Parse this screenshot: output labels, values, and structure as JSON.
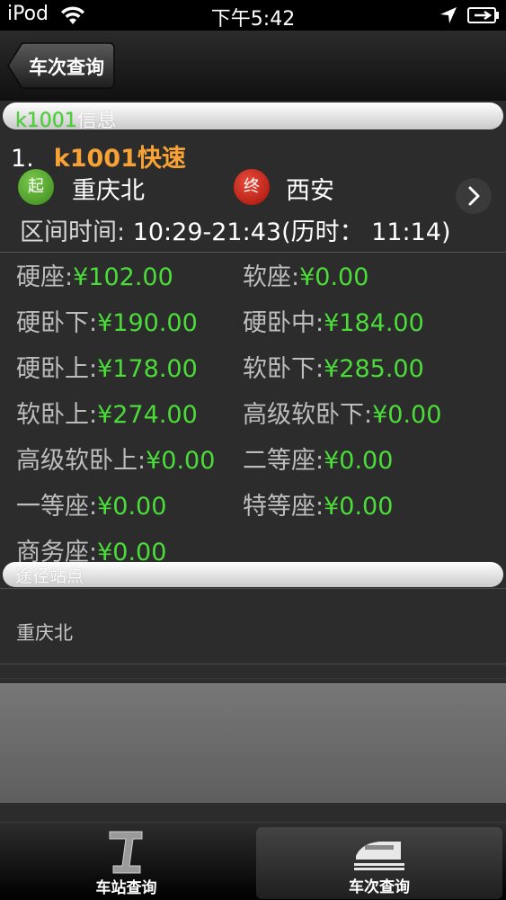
{
  "status_bar": {
    "carrier": "iPod",
    "time": "下午5:42"
  },
  "nav": {
    "back_label": "车次查询"
  },
  "info_section": {
    "code": "k1001",
    "suffix": "信息"
  },
  "train": {
    "index": "1.",
    "name": "k1001快速",
    "start_badge": "起",
    "start_station": "重庆北",
    "end_badge": "终",
    "end_station": "西安",
    "interval_label": "区间时间:",
    "interval_value": "10:29-21:43(历时：  11:14)"
  },
  "prices": [
    {
      "label": "硬座:",
      "value": "¥102.00"
    },
    {
      "label": "软座:",
      "value": "¥0.00"
    },
    {
      "label": "硬卧下:",
      "value": "¥190.00"
    },
    {
      "label": "硬卧中:",
      "value": "¥184.00"
    },
    {
      "label": "硬卧上:",
      "value": "¥178.00"
    },
    {
      "label": "软卧下:",
      "value": "¥285.00"
    },
    {
      "label": "软卧上:",
      "value": "¥274.00"
    },
    {
      "label": "高级软卧下:",
      "value": "¥0.00"
    },
    {
      "label": "高级软卧上:",
      "value": "¥0.00"
    },
    {
      "label": "二等座:",
      "value": "¥0.00"
    },
    {
      "label": "一等座:",
      "value": "¥0.00"
    },
    {
      "label": "特等座:",
      "value": "¥0.00"
    },
    {
      "label": "商务座:",
      "value": "¥0.00"
    }
  ],
  "stations_section": {
    "title": "途径站点",
    "items": [
      "重庆北"
    ]
  },
  "tabs": [
    {
      "label": "车站查询",
      "icon": "station-query-icon",
      "selected": false
    },
    {
      "label": "车次查询",
      "icon": "train-query-icon",
      "selected": true
    }
  ],
  "colors": {
    "price_green": "#4bdc3a",
    "train_orange": "#f7a234",
    "code_green": "#44d430"
  }
}
